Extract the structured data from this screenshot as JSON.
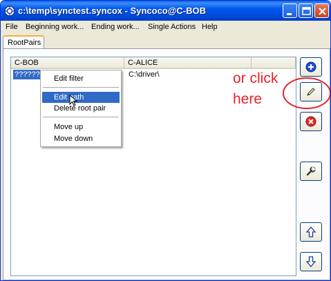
{
  "window": {
    "title": "c:\\temp\\synctest.syncox - Syncoco@C-BOB",
    "colors": {
      "titlebar": "#0054e3",
      "selection": "#316ac5",
      "annotation": "#e8222a"
    }
  },
  "titlebar_buttons": {
    "minimize": "minimize-icon",
    "maximize": "maximize-icon",
    "close": "close-icon"
  },
  "menu": [
    "File",
    "Beginning work...",
    "Ending work...",
    "Single Actions",
    "Help"
  ],
  "tabs": [
    {
      "label": "RootPairs",
      "active": true
    }
  ],
  "table": {
    "columns": [
      "C-BOB",
      "C-ALICE",
      ""
    ],
    "rows": [
      {
        "c_bob": "????????",
        "c_alice": "C:\\driver\\",
        "selected": true
      }
    ]
  },
  "context_menu": {
    "items": [
      {
        "label": "Edit filter"
      },
      {
        "label": "Edit path",
        "highlighted": true
      },
      {
        "label": "Delete root pair"
      },
      {
        "label": "Move up"
      },
      {
        "label": "Move down"
      }
    ]
  },
  "side_buttons": [
    {
      "icon": "plus-icon"
    },
    {
      "icon": "pencil-icon"
    },
    {
      "icon": "delete-icon"
    },
    {
      "icon": "wrench-icon"
    },
    {
      "icon": "arrow-up-icon"
    },
    {
      "icon": "arrow-down-icon"
    }
  ],
  "annotation": {
    "line1": "or click",
    "line2": "here"
  }
}
